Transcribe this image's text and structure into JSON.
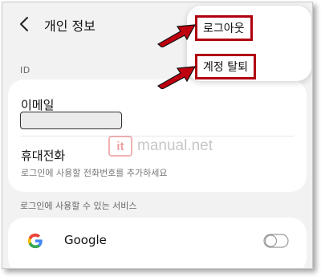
{
  "header": {
    "back_icon": "chevron-left-icon",
    "title": "개인 정보"
  },
  "sections": {
    "id_label": "ID",
    "services_label": "로그인에 사용할 수 있는 서비스"
  },
  "account": {
    "email_label": "이메일",
    "email_value": "",
    "phone_label": "휴대전화",
    "phone_desc": "로그인에 사용할 전화번호를 추가하세요"
  },
  "services": [
    {
      "name": "Google",
      "icon": "google-logo-icon",
      "enabled": false
    }
  ],
  "menu": {
    "logout_label": "로그아웃",
    "delete_account_label": "계정 탈퇴"
  },
  "watermark": {
    "badge_text": "it",
    "site_text": "manual.net"
  },
  "colors": {
    "highlight": "#b00010",
    "arrow_fill": "#c0000e",
    "background": "#f2f2f2",
    "card": "#ffffff"
  }
}
